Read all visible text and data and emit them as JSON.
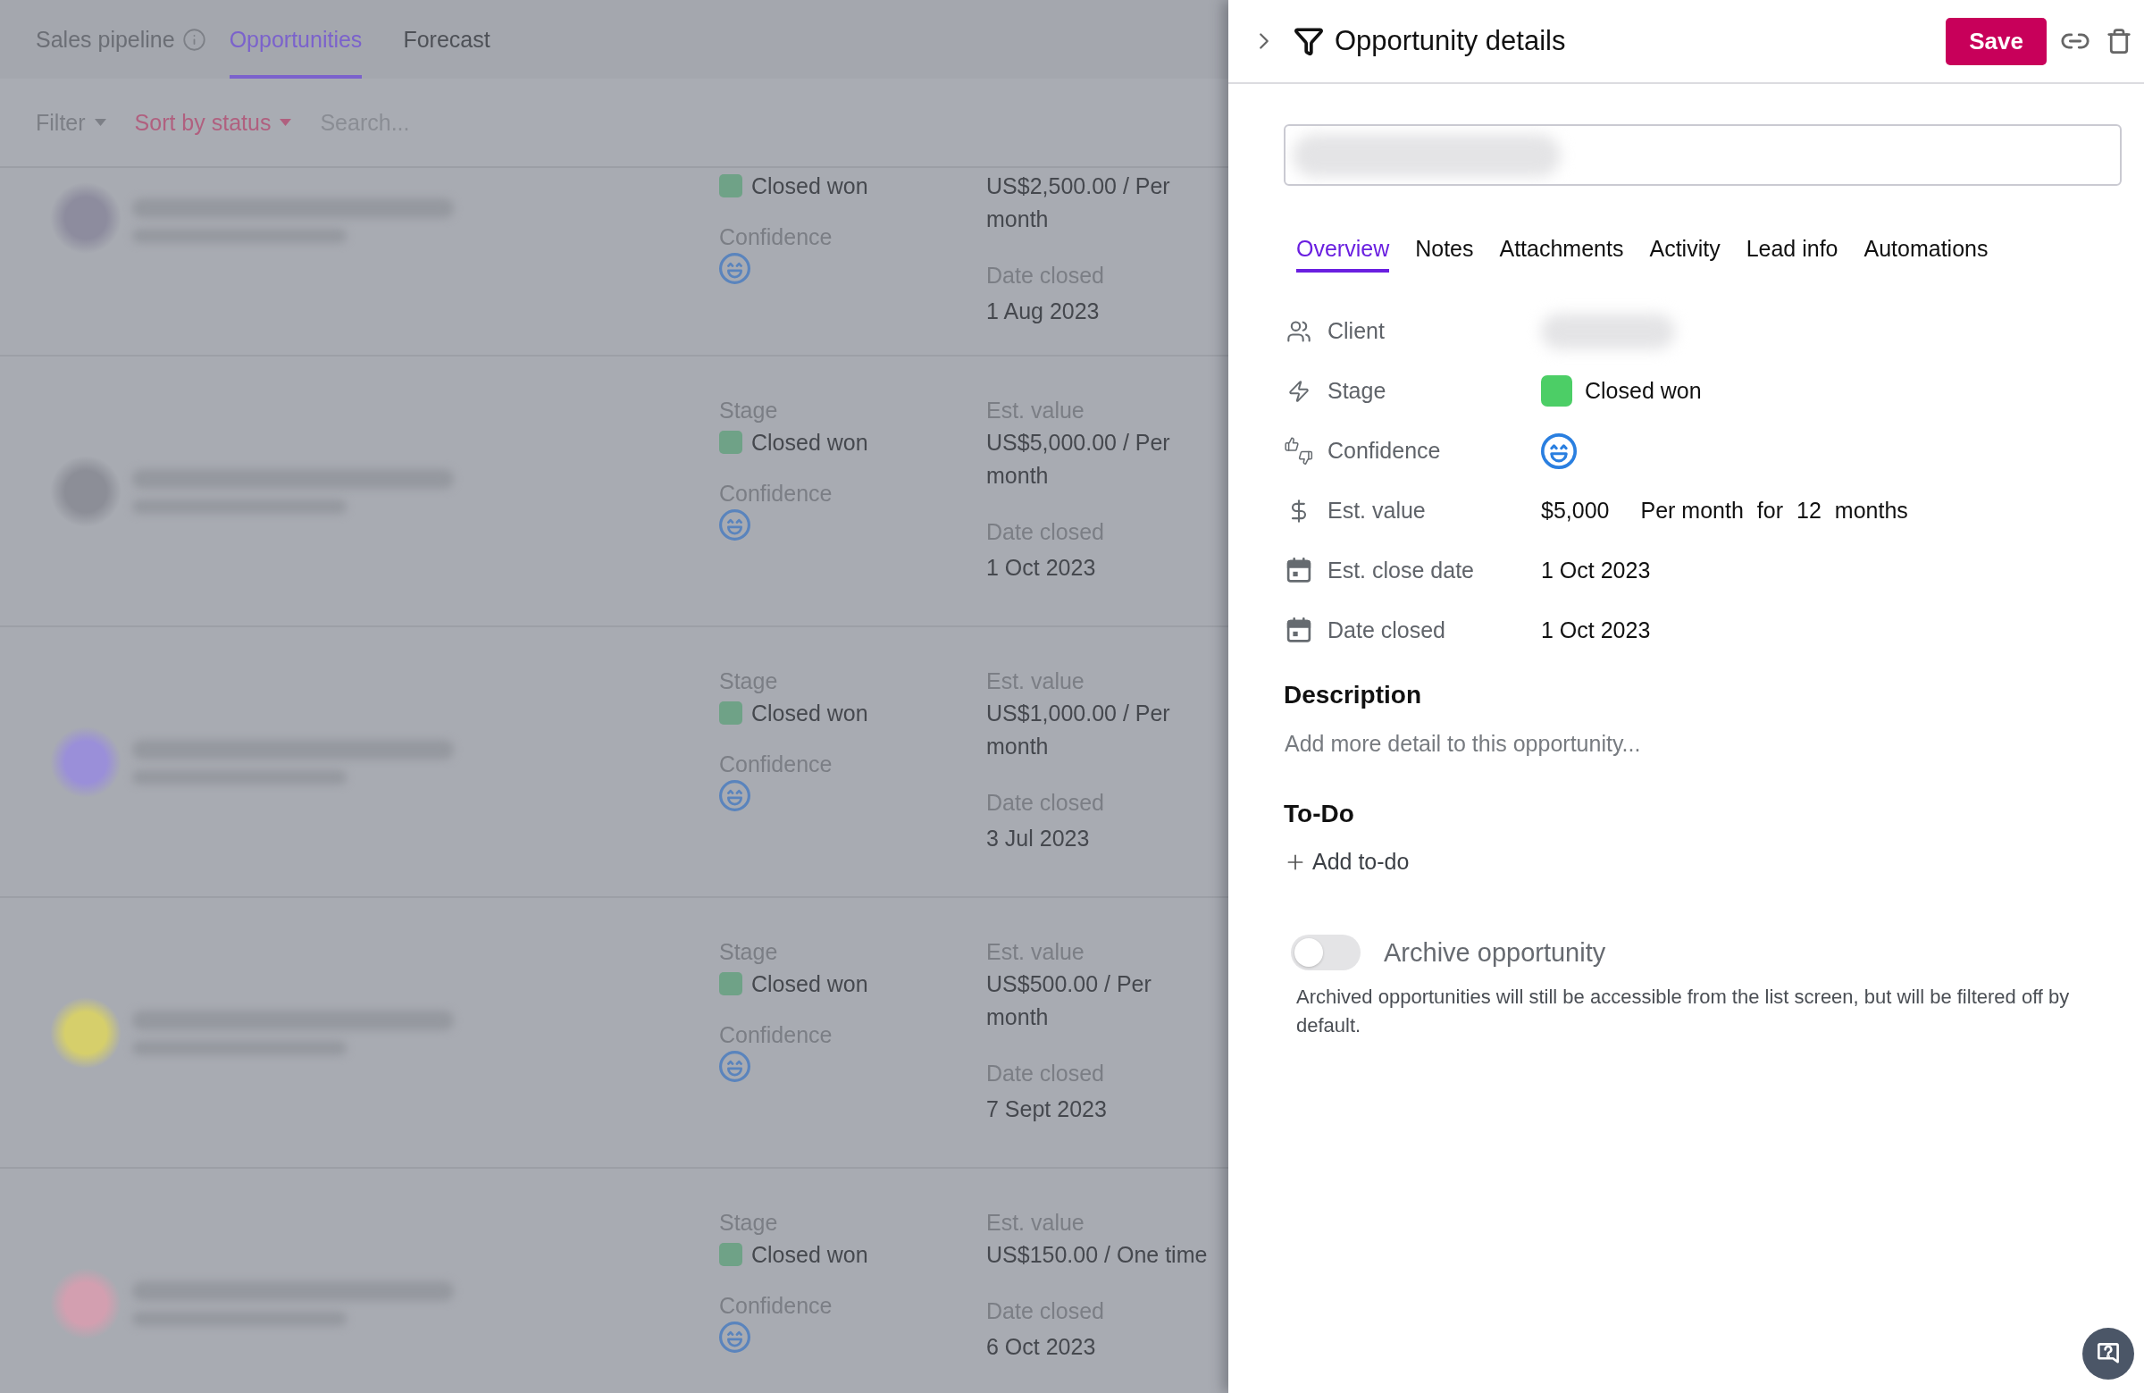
{
  "page": {
    "title": "Sales pipeline"
  },
  "tabs": [
    {
      "label": "Opportunities",
      "selected": true
    },
    {
      "label": "Forecast",
      "selected": false
    }
  ],
  "toolbar": {
    "menus": [
      {
        "label": "Filter",
        "active": false
      },
      {
        "label": "Sort by status",
        "active": true
      }
    ],
    "search": {
      "placeholder": "Search..."
    }
  },
  "opportunities": [
    {
      "color": "#8d8c9e",
      "stage": "Closed won",
      "confidence_label": "Confidence",
      "value": "US$2,500.00 / Per month",
      "date_label": "Date closed",
      "date": "1 Aug 2023"
    },
    {
      "color": "#8c8e97",
      "stage_label": "Stage",
      "stage": "Closed won",
      "confidence_label": "Confidence",
      "value_label": "Est. value",
      "value": "US$5,000.00 / Per month",
      "date_label": "Date closed",
      "date": "1 Oct 2023"
    },
    {
      "color": "#9a8fd9",
      "stage_label": "Stage",
      "stage": "Closed won",
      "confidence_label": "Confidence",
      "value_label": "Est. value",
      "value": "US$1,000.00 / Per month",
      "date_label": "Date closed",
      "date": "3 Jul 2023"
    },
    {
      "color": "#d6cf6b",
      "stage_label": "Stage",
      "stage": "Closed won",
      "confidence_label": "Confidence",
      "value_label": "Est. value",
      "value": "US$500.00 / Per month",
      "date_label": "Date closed",
      "date": "7 Sept 2023"
    },
    {
      "color": "#d39fb0",
      "stage_label": "Stage",
      "stage": "Closed won",
      "confidence_label": "Confidence",
      "value_label": "Est. value",
      "value": "US$150.00 / One time",
      "date_label": "Date closed",
      "date": "6 Oct 2023"
    }
  ],
  "details": {
    "title": "Opportunity details",
    "save": "Save",
    "tabs": [
      {
        "label": "Overview",
        "selected": true
      },
      {
        "label": "Notes",
        "selected": false
      },
      {
        "label": "Attachments",
        "selected": false
      },
      {
        "label": "Activity",
        "selected": false
      },
      {
        "label": "Lead info",
        "selected": false
      },
      {
        "label": "Automations",
        "selected": false
      }
    ],
    "fields": [
      {
        "kind": "client",
        "label": "Client"
      },
      {
        "kind": "stage",
        "label": "Stage",
        "value": "Closed won"
      },
      {
        "kind": "confidence",
        "label": "Confidence"
      },
      {
        "kind": "value",
        "label": "Est. value",
        "amount": "$5,000",
        "period": "Per month",
        "joiner": "for",
        "count": "12",
        "unit": "months"
      },
      {
        "kind": "date",
        "label": "Est. close date",
        "value": "1 Oct 2023"
      },
      {
        "kind": "date",
        "label": "Date closed",
        "value": "1 Oct 2023"
      }
    ],
    "description": {
      "heading": "Description",
      "placeholder": "Add more detail to this opportunity..."
    },
    "todo": {
      "heading": "To-Do",
      "action": "Add to-do"
    },
    "archive": {
      "label": "Archive opportunity",
      "on": false,
      "note": "Archived opportunities will still be accessible from the list screen, but will be filtered off by default."
    }
  }
}
